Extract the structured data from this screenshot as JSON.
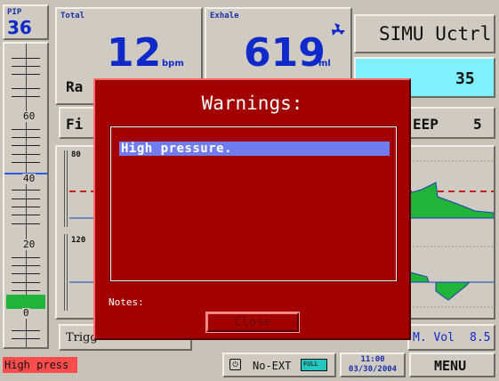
{
  "pip": {
    "label": "PIP",
    "value": "36"
  },
  "total": {
    "label": "Total",
    "value": "12",
    "unit": "bpm",
    "sub_label": "Ra"
  },
  "exhale": {
    "label": "Exhale",
    "value": "619",
    "unit": "ml"
  },
  "mode": {
    "label": "SIMU Uctrl"
  },
  "param_right": {
    "value": "35"
  },
  "fi_label": "Fi",
  "peep": {
    "label": "EEP",
    "value": "5"
  },
  "scale": {
    "labels": [
      "60",
      "40",
      "20",
      "0"
    ]
  },
  "waves": {
    "top_label": "80",
    "bottom_label": "120"
  },
  "bottom_params": {
    "trigger_label": "Trigg",
    "mvol_label": "M. Vol",
    "mvol_value": "8.5"
  },
  "status": {
    "alarm_text": "High press",
    "ext_label": "No-EXT",
    "battery_label": "FULL",
    "time": "11:00",
    "date": "03/30/2004",
    "menu_label": "MENU"
  },
  "dialog": {
    "title": "Warnings:",
    "warnings": [
      "High pressure."
    ],
    "notes_label": "Notes:",
    "close_label": "Close"
  },
  "colors": {
    "dialog_bg": "#a30000",
    "value_blue": "#1029c9",
    "highlight": "#6f7df0",
    "selected_param": "#7ff0ff",
    "alarm_red": "#ff4d4d",
    "wave_fill": "#22b43a"
  }
}
